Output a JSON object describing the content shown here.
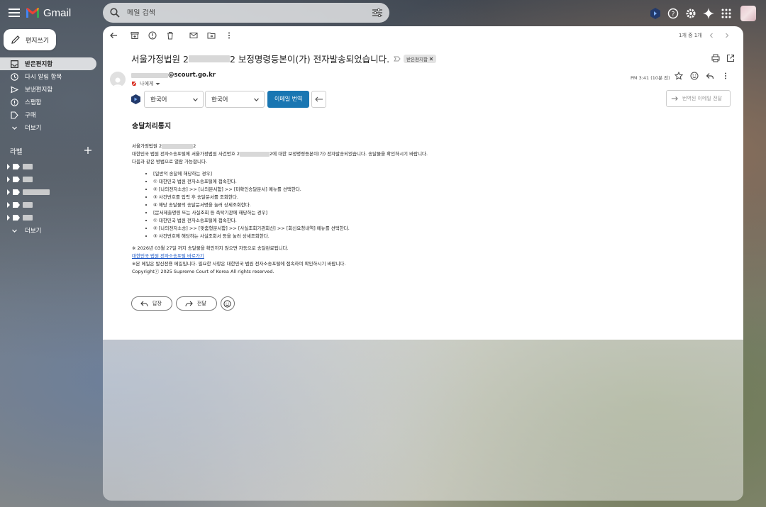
{
  "header": {
    "app_name": "Gmail",
    "search_placeholder": "메일 검색"
  },
  "compose": {
    "label": "편지쓰기"
  },
  "nav": {
    "items": [
      {
        "label": "받은편지함",
        "icon": "inbox-icon",
        "active": true
      },
      {
        "label": "다시 알림 항목",
        "icon": "clock-icon"
      },
      {
        "label": "보낸편지함",
        "icon": "send-icon"
      },
      {
        "label": "스팸함",
        "icon": "spam-icon"
      },
      {
        "label": "구매",
        "icon": "tag-icon"
      },
      {
        "label": "더보기",
        "icon": "chevron-down-icon"
      }
    ],
    "labels_title": "라벨",
    "labels_more": "더보기"
  },
  "toolbar": {
    "pager": "1개 중 1개"
  },
  "email": {
    "subject_prefix": "서울가정법원 2",
    "subject_suffix": "2 보정명령등본이(가) 전자발송되었습니다.",
    "chip_label": "받은편지함",
    "sender_domain": "@scourt.go.kr",
    "to_me": "나에게",
    "time": "PM 3:41 (10분 전)"
  },
  "translate": {
    "source_lang": "한국어",
    "target_lang": "한국어",
    "translate_button": "이메일 번역",
    "forward_translated": "번역된 이메일 전달"
  },
  "body": {
    "heading": "송달처리통지",
    "line1_prefix": "서울가정법원 2",
    "line1_suffix": "2",
    "line2_prefix": "대한민국 법원 전자소송포털에 서울가정법원 사건번호 2",
    "line2_suffix": "2에 대한 보정명령등본이(가) 전자발송되었습니다. 송달물을 확인하시기 바랍니다.",
    "line3": "다음과 같은 방법으로 열람 가능합니다.",
    "bullets": [
      "[일반적 송달에 해당하는 경우]",
      "① 대한민국 법원 전자소송포털에 접속한다.",
      "② [나의전자소송] >> [나의문서함] >> [미확인송달문서] 메뉴를 선택한다.",
      "③ 사건번호를 입력 후 송달문서를 조회한다.",
      "④ 해당 송달물의 송달문서명을 눌러 상세조회한다.",
      "[문서제출명령 또는 사실조회 등 촉탁기관에 해당하는 경우]",
      "① 대한민국 법원 전자소송포털에 접속한다.",
      "② [나의전자소송] >> [맞춤형문서함] >> [사실조회기관회신] >> [회신요청내역] 메뉴를 선택한다.",
      "③ 사건번호에 해당하는 사실조회서 등을 눌러 상세조회한다."
    ],
    "note1": "※ 2026년 03월 27일 까지 송달물을 확인하지 않으면 자동으로 송달완료됩니다.",
    "link": "대한민국 법원 전자소송포털 바로가기",
    "note2": "※본 메일은 발신전용 메일입니다. 필요한 사항은 대한민국 법원 전자소송포털에 접속하여 확인하시기 바랍니다.",
    "copyright": "Copyrightⓒ 2025 Supreme Court of Korea All rights reserved."
  },
  "actions": {
    "reply": "답장",
    "forward": "전달"
  },
  "colors": {
    "accent_blue": "#1976b2",
    "link_blue": "#1a56c5"
  }
}
